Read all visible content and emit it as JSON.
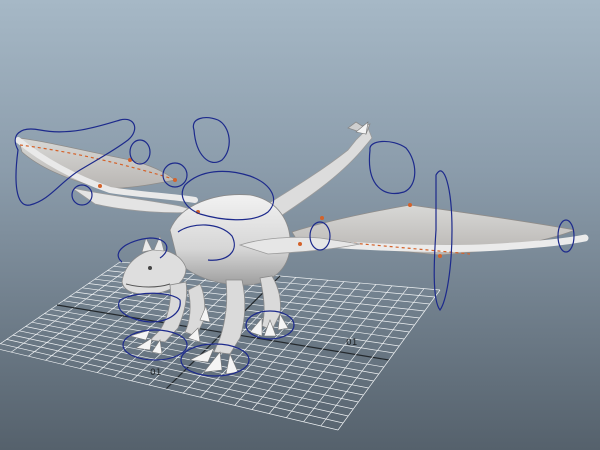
{
  "viewport": {
    "background_top": "#a6b8c6",
    "background_bottom": "#55616c",
    "grid": {
      "labels": [
        "01",
        "01"
      ]
    },
    "model": {
      "color": "#e0e0e0",
      "control_curve_color": "#1d2a8c",
      "joint_color": "#d4622a"
    }
  }
}
